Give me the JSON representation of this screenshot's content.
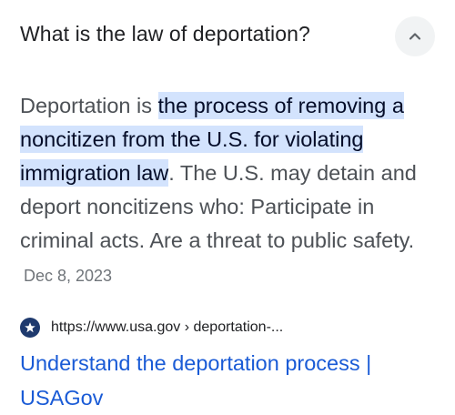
{
  "question": {
    "text": "What is the law of deportation?"
  },
  "collapse_button": {
    "icon": "chevron-up-icon"
  },
  "answer": {
    "before_highlight": "Deportation is ",
    "highlight": "the process of removing a noncitizen from the U.S. for violating immigration law",
    "after_highlight": ". The U.S. may detain and deport noncitizens who: Participate in criminal acts. Are a threat to public safety.",
    "date": "Dec 8, 2023"
  },
  "source": {
    "icon": "usa-gov-favicon-icon",
    "url": "https://www.usa.gov › deportation-...",
    "title": "Understand the deportation process | USAGov"
  },
  "colors": {
    "highlight_bg": "#d3e3fd",
    "link": "#1a5bd6",
    "favicon_bg": "#1f3a6e"
  }
}
